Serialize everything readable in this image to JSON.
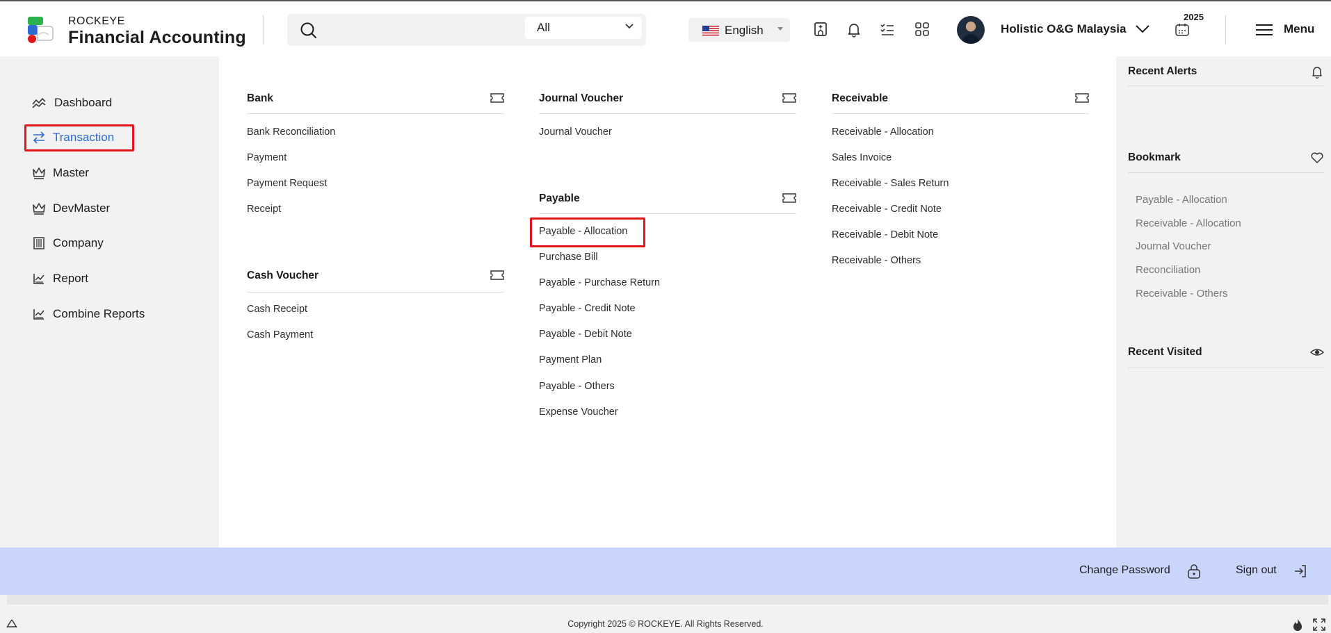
{
  "brand": {
    "small": "ROCKEYE",
    "big": "Financial Accounting"
  },
  "search": {
    "placeholder": "",
    "scope": "All"
  },
  "language": "English",
  "company": "Holistic O&G Malaysia",
  "year": "2025",
  "menu_label": "Menu",
  "sidebar": {
    "items": [
      {
        "label": "Dashboard",
        "icon": "chart-line-icon",
        "active": false
      },
      {
        "label": "Transaction",
        "icon": "transfer-arrows-icon",
        "active": true
      },
      {
        "label": "Master",
        "icon": "crown-icon",
        "active": false
      },
      {
        "label": "DevMaster",
        "icon": "crown-icon",
        "active": false
      },
      {
        "label": "Company",
        "icon": "building-icon",
        "active": false
      },
      {
        "label": "Report",
        "icon": "report-chart-icon",
        "active": false
      },
      {
        "label": "Combine Reports",
        "icon": "report-chart-icon",
        "active": false
      }
    ]
  },
  "groups": {
    "bank": {
      "title": "Bank",
      "links": [
        "Bank Reconciliation",
        "Payment",
        "Payment Request",
        "Receipt"
      ]
    },
    "cash": {
      "title": "Cash Voucher",
      "links": [
        "Cash Receipt",
        "Cash Payment"
      ]
    },
    "journal": {
      "title": "Journal Voucher",
      "links": [
        "Journal Voucher"
      ]
    },
    "payable": {
      "title": "Payable",
      "links": [
        "Payable - Allocation",
        "Purchase Bill",
        "Payable - Purchase Return",
        "Payable - Credit Note",
        "Payable - Debit Note",
        "Payment Plan",
        "Payable - Others",
        "Expense Voucher"
      ]
    },
    "receivable": {
      "title": "Receivable",
      "links": [
        "Receivable - Allocation",
        "Sales Invoice",
        "Receivable - Sales Return",
        "Receivable - Credit Note",
        "Receivable - Debit Note",
        "Receivable - Others"
      ]
    }
  },
  "right_panel": {
    "recent_alerts": "Recent Alerts",
    "bookmark": "Bookmark",
    "bookmarks": [
      "Payable - Allocation",
      "Receivable - Allocation",
      "Journal Voucher",
      "Reconciliation",
      "Receivable - Others"
    ],
    "recent_visited": "Recent Visited"
  },
  "footer": {
    "change_password": "Change Password",
    "sign_out": "Sign out",
    "copyright": "Copyright 2025 © ROCKEYE. All Rights Reserved."
  },
  "colors": {
    "accent": "#2d6bd3",
    "highlight": "#e3151a",
    "bottombar": "#cad5fb"
  }
}
